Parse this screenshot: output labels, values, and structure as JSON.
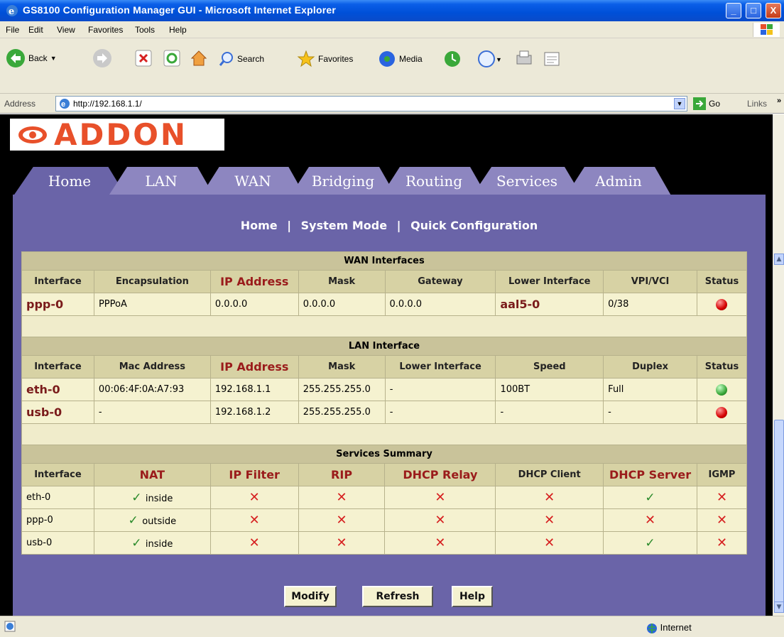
{
  "window": {
    "title": "GS8100 Configuration Manager GUI - Microsoft Internet Explorer",
    "minimize": "_",
    "maximize": "□",
    "close": "X"
  },
  "menu": [
    "File",
    "Edit",
    "View",
    "Favorites",
    "Tools",
    "Help"
  ],
  "toolbar": {
    "back": "Back",
    "search": "Search",
    "favorites": "Favorites",
    "media": "Media"
  },
  "address": {
    "label": "Address",
    "url": "http://192.168.1.1/",
    "go": "Go",
    "links": "Links"
  },
  "logo": {
    "text": "ADDON"
  },
  "tabs": [
    "Home",
    "LAN",
    "WAN",
    "Bridging",
    "Routing",
    "Services",
    "Admin"
  ],
  "sublinks": {
    "home": "Home",
    "system_mode": "System Mode",
    "quick_config": "Quick Configuration",
    "sep": "|"
  },
  "wan": {
    "title": "WAN Interfaces",
    "headers": [
      "Interface",
      "Encapsulation",
      "IP Address",
      "Mask",
      "Gateway",
      "Lower Interface",
      "VPI/VCI",
      "Status"
    ],
    "rows": [
      {
        "interface": "ppp-0",
        "encapsulation": "PPPoA",
        "ip": "0.0.0.0",
        "mask": "0.0.0.0",
        "gateway": "0.0.0.0",
        "lower": "aal5-0",
        "vpivci": "0/38",
        "status": "red"
      }
    ]
  },
  "lan": {
    "title": "LAN Interface",
    "headers": [
      "Interface",
      "Mac Address",
      "IP Address",
      "Mask",
      "Lower Interface",
      "Speed",
      "Duplex",
      "Status"
    ],
    "rows": [
      {
        "interface": "eth-0",
        "mac": "00:06:4F:0A:A7:93",
        "ip": "192.168.1.1",
        "mask": "255.255.255.0",
        "lower": "-",
        "speed": "100BT",
        "duplex": "Full",
        "status": "green"
      },
      {
        "interface": "usb-0",
        "mac": "-",
        "ip": "192.168.1.2",
        "mask": "255.255.255.0",
        "lower": "-",
        "speed": "-",
        "duplex": "-",
        "status": "red"
      }
    ]
  },
  "services": {
    "title": "Services Summary",
    "headers": [
      "Interface",
      "NAT",
      "IP Filter",
      "RIP",
      "DHCP Relay",
      "DHCP Client",
      "DHCP Server",
      "IGMP"
    ],
    "rows": [
      {
        "interface": "eth-0",
        "nat": "inside",
        "ip_filter": "no",
        "rip": "no",
        "dhcp_relay": "no",
        "dhcp_client": "no",
        "dhcp_server": "yes",
        "igmp": "no"
      },
      {
        "interface": "ppp-0",
        "nat": "outside",
        "ip_filter": "no",
        "rip": "no",
        "dhcp_relay": "no",
        "dhcp_client": "no",
        "dhcp_server": "no",
        "igmp": "no"
      },
      {
        "interface": "usb-0",
        "nat": "inside",
        "ip_filter": "no",
        "rip": "no",
        "dhcp_relay": "no",
        "dhcp_client": "no",
        "dhcp_server": "yes",
        "igmp": "no"
      }
    ]
  },
  "buttons": {
    "modify": "Modify",
    "refresh": "Refresh",
    "help": "Help"
  },
  "status": {
    "zone": "Internet"
  },
  "colors": {
    "accent": "#6a64a8",
    "tab": "#8d86c0",
    "logo": "#e8502a",
    "header_red": "#9a1b1b"
  }
}
